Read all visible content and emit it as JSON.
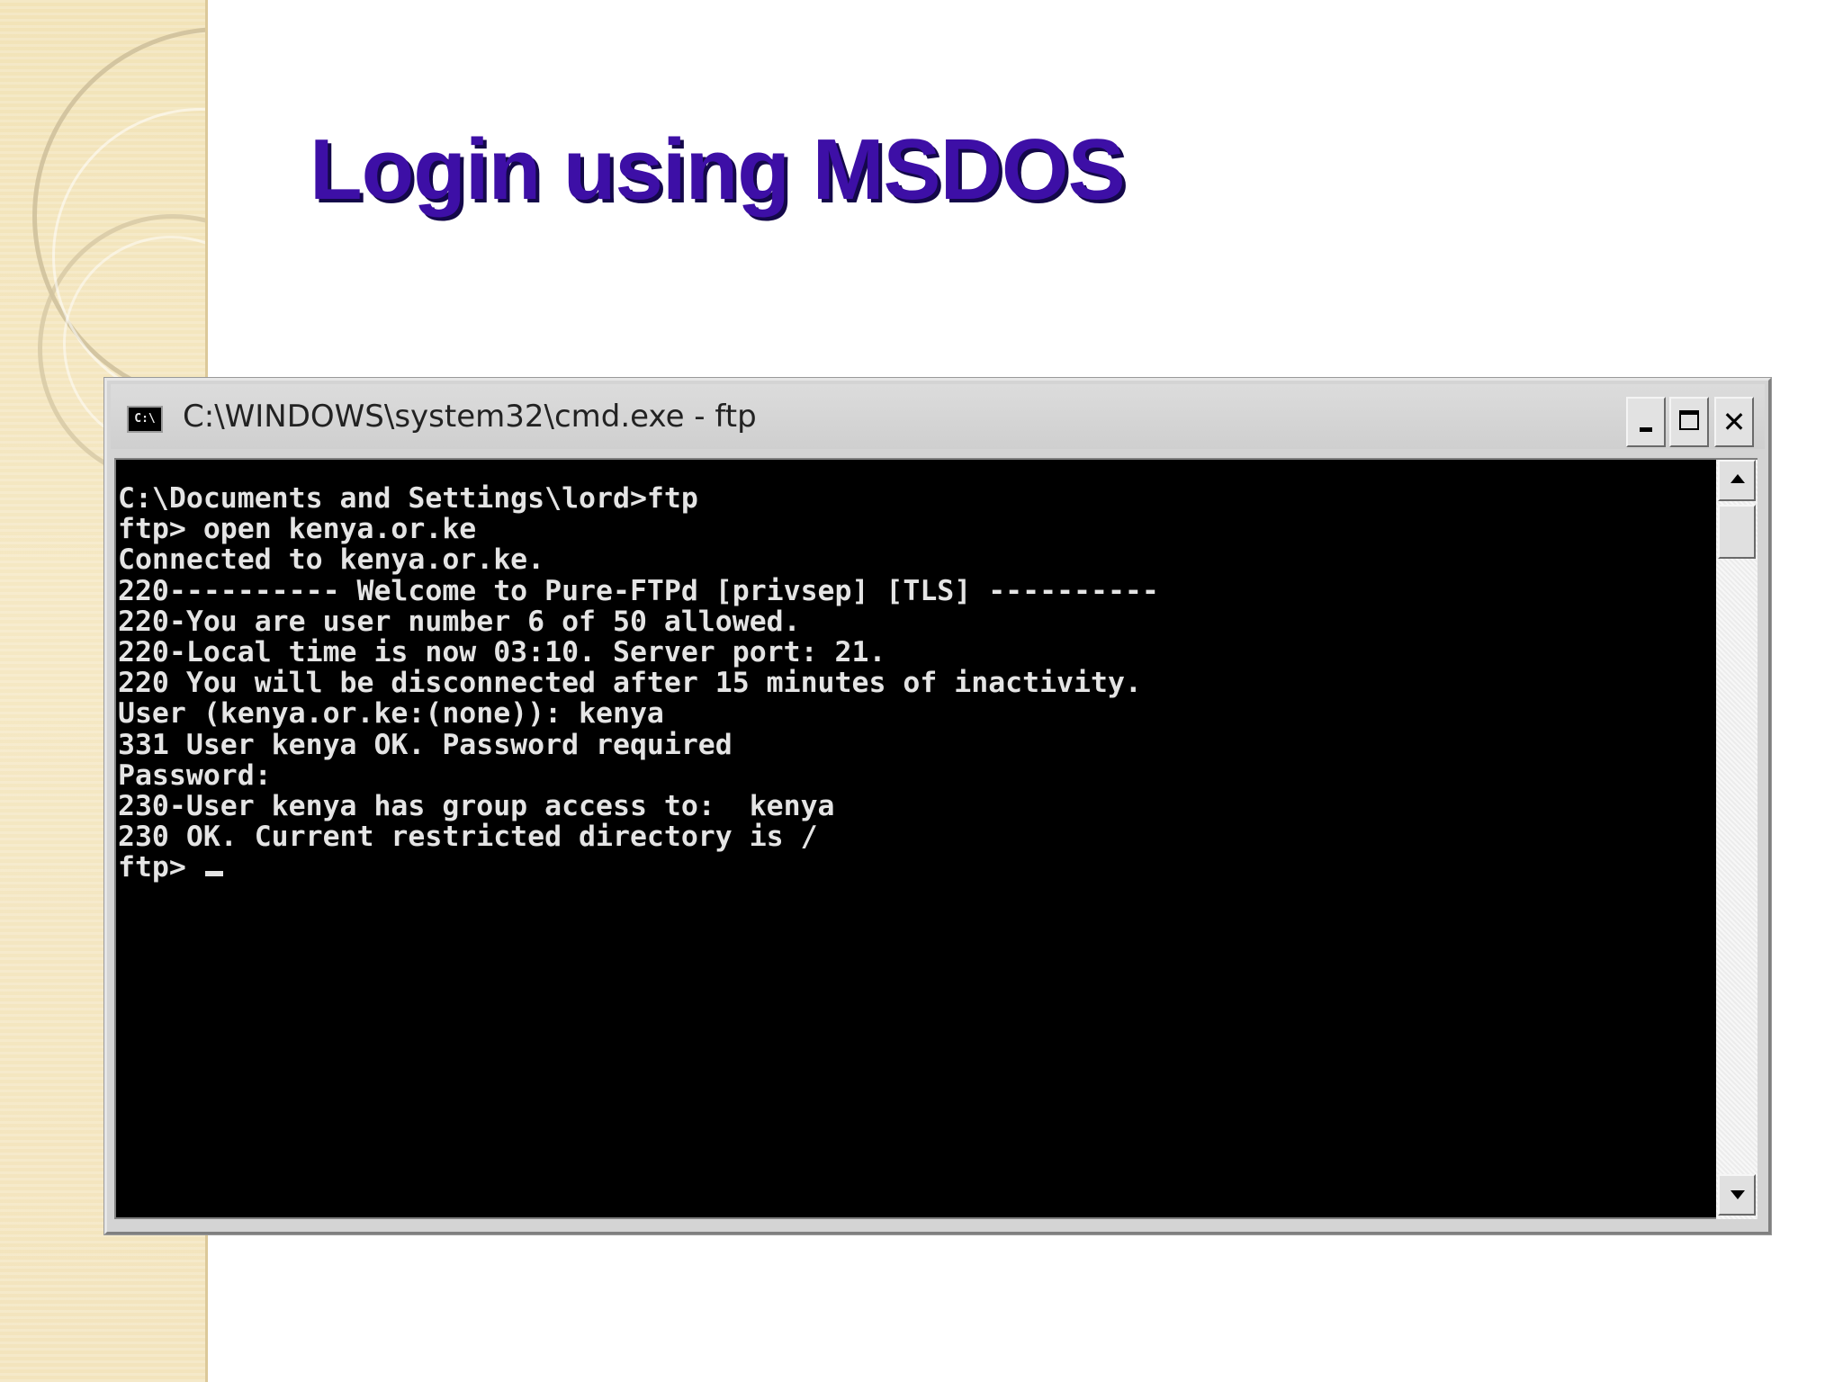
{
  "slide": {
    "title": "Login using MSDOS"
  },
  "window": {
    "icon_label": "C:\\",
    "title": "C:\\WINDOWS\\system32\\cmd.exe - ftp",
    "controls": {
      "minimize": "minimize-icon",
      "maximize": "maximize-icon",
      "close_label": "✕"
    }
  },
  "console": {
    "lines": [
      "C:\\Documents and Settings\\lord>ftp",
      "ftp> open kenya.or.ke",
      "Connected to kenya.or.ke.",
      "220---------- Welcome to Pure-FTPd [privsep] [TLS] ----------",
      "220-You are user number 6 of 50 allowed.",
      "220-Local time is now 03:10. Server port: 21.",
      "220 You will be disconnected after 15 minutes of inactivity.",
      "User (kenya.or.ke:(none)): kenya",
      "331 User kenya OK. Password required",
      "Password:",
      "230-User kenya has group access to:  kenya",
      "230 OK. Current restricted directory is /"
    ],
    "prompt": "ftp> "
  },
  "colors": {
    "title": "#3d0fa6",
    "console_bg": "#000000",
    "console_text": "#e4e4e4",
    "side_band": "#f2e3b8"
  }
}
